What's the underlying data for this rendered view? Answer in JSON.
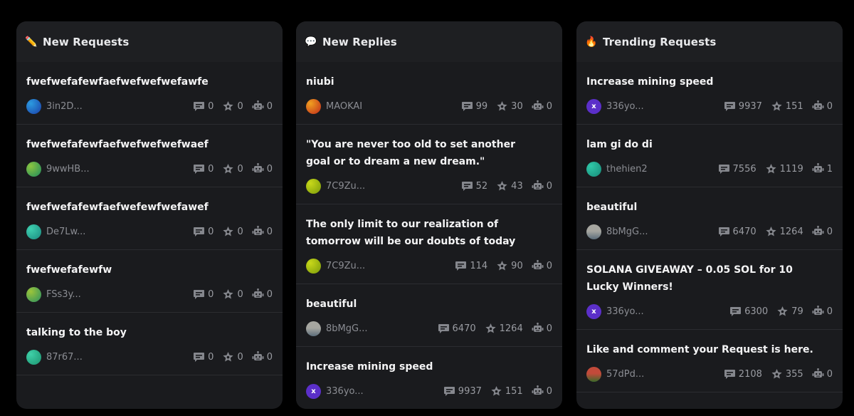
{
  "colors": {
    "background": "#000000",
    "panel": "#1a1b1e",
    "divider": "#2b2c30",
    "muted_text": "#8b8d93",
    "icon": "#85878d"
  },
  "panels": [
    {
      "key": "new-requests",
      "emoji": "✏️",
      "title": "New Requests",
      "items": [
        {
          "title": "fwefwefafewfaefwefwefwefawfe",
          "author": "3in2D...",
          "avatar": {
            "style": "gradient",
            "colors": [
              "#2c9be0",
              "#1a3fa8"
            ]
          },
          "comments": "0",
          "stars": "0",
          "bots": "0"
        },
        {
          "title": "fwefwefafewfaefwefwefwefwaef",
          "author": "9wwHB...",
          "avatar": {
            "style": "gradient",
            "colors": [
              "#8bc540",
              "#1e8a5c"
            ]
          },
          "comments": "0",
          "stars": "0",
          "bots": "0"
        },
        {
          "title": "fwefwefafewfaefwefewfwefawef",
          "author": "De7Lw...",
          "avatar": {
            "style": "gradient",
            "colors": [
              "#3fd0b0",
              "#1a8a80"
            ]
          },
          "comments": "0",
          "stars": "0",
          "bots": "0"
        },
        {
          "title": "fwefwefafewfw",
          "author": "FSs3y...",
          "avatar": {
            "style": "gradient",
            "colors": [
              "#9cc43a",
              "#2a9060"
            ]
          },
          "comments": "0",
          "stars": "0",
          "bots": "0"
        },
        {
          "title": "talking to the boy",
          "author": "87r67...",
          "avatar": {
            "style": "gradient",
            "colors": [
              "#3fd0a8",
              "#1b9470"
            ]
          },
          "comments": "0",
          "stars": "0",
          "bots": "0"
        }
      ]
    },
    {
      "key": "new-replies",
      "emoji": "💬",
      "title": "New Replies",
      "items": [
        {
          "title": "niubi",
          "author": "MAOKAI",
          "avatar": {
            "style": "gradient",
            "colors": [
              "#f0a020",
              "#c02a1a"
            ]
          },
          "comments": "99",
          "stars": "30",
          "bots": "0"
        },
        {
          "title": "\"You are never too old to set another goal or to dream a new dream.\"",
          "author": "7C9Zu...",
          "avatar": {
            "style": "gradient",
            "colors": [
              "#c8d81a",
              "#7a9a0a"
            ]
          },
          "comments": "52",
          "stars": "43",
          "bots": "0"
        },
        {
          "title": "The only limit to our realization of tomorrow will be our doubts of today",
          "author": "7C9Zu...",
          "avatar": {
            "style": "gradient",
            "colors": [
              "#c8d81a",
              "#7a9a0a"
            ]
          },
          "comments": "114",
          "stars": "90",
          "bots": "0"
        },
        {
          "title": "beautiful",
          "author": "8bMgG...",
          "avatar": {
            "style": "photo",
            "colors": [
              "#a6a6a0",
              "#5b6d7a"
            ]
          },
          "comments": "6470",
          "stars": "1264",
          "bots": "0"
        },
        {
          "title": "Increase mining speed",
          "author": "336yo...",
          "avatar": {
            "style": "letter",
            "letter": "x",
            "colors": [
              "#5b2fc9",
              "#4322a8"
            ]
          },
          "comments": "9937",
          "stars": "151",
          "bots": "0"
        }
      ]
    },
    {
      "key": "trending-requests",
      "emoji": "🔥",
      "title": "Trending Requests",
      "items": [
        {
          "title": "Increase mining speed",
          "author": "336yo...",
          "avatar": {
            "style": "letter",
            "letter": "x",
            "colors": [
              "#5b2fc9",
              "#4322a8"
            ]
          },
          "comments": "9937",
          "stars": "151",
          "bots": "0"
        },
        {
          "title": "lam gi do di",
          "author": "thehien2",
          "avatar": {
            "style": "gradient",
            "colors": [
              "#30c8a8",
              "#168a78"
            ]
          },
          "comments": "7556",
          "stars": "1119",
          "bots": "1"
        },
        {
          "title": "beautiful",
          "author": "8bMgG...",
          "avatar": {
            "style": "photo",
            "colors": [
              "#a6a6a0",
              "#5b6d7a"
            ]
          },
          "comments": "6470",
          "stars": "1264",
          "bots": "0"
        },
        {
          "title": "SOLANA GIVEAWAY – 0.05 SOL for 10 Lucky Winners!",
          "author": "336yo...",
          "avatar": {
            "style": "letter",
            "letter": "x",
            "colors": [
              "#5b2fc9",
              "#4322a8"
            ]
          },
          "comments": "6300",
          "stars": "79",
          "bots": "0"
        },
        {
          "title": "Like and comment your Request is here.",
          "author": "57dPd...",
          "avatar": {
            "style": "photo",
            "colors": [
              "#c24a3a",
              "#3a6a2a"
            ]
          },
          "comments": "2108",
          "stars": "355",
          "bots": "0"
        }
      ]
    }
  ]
}
